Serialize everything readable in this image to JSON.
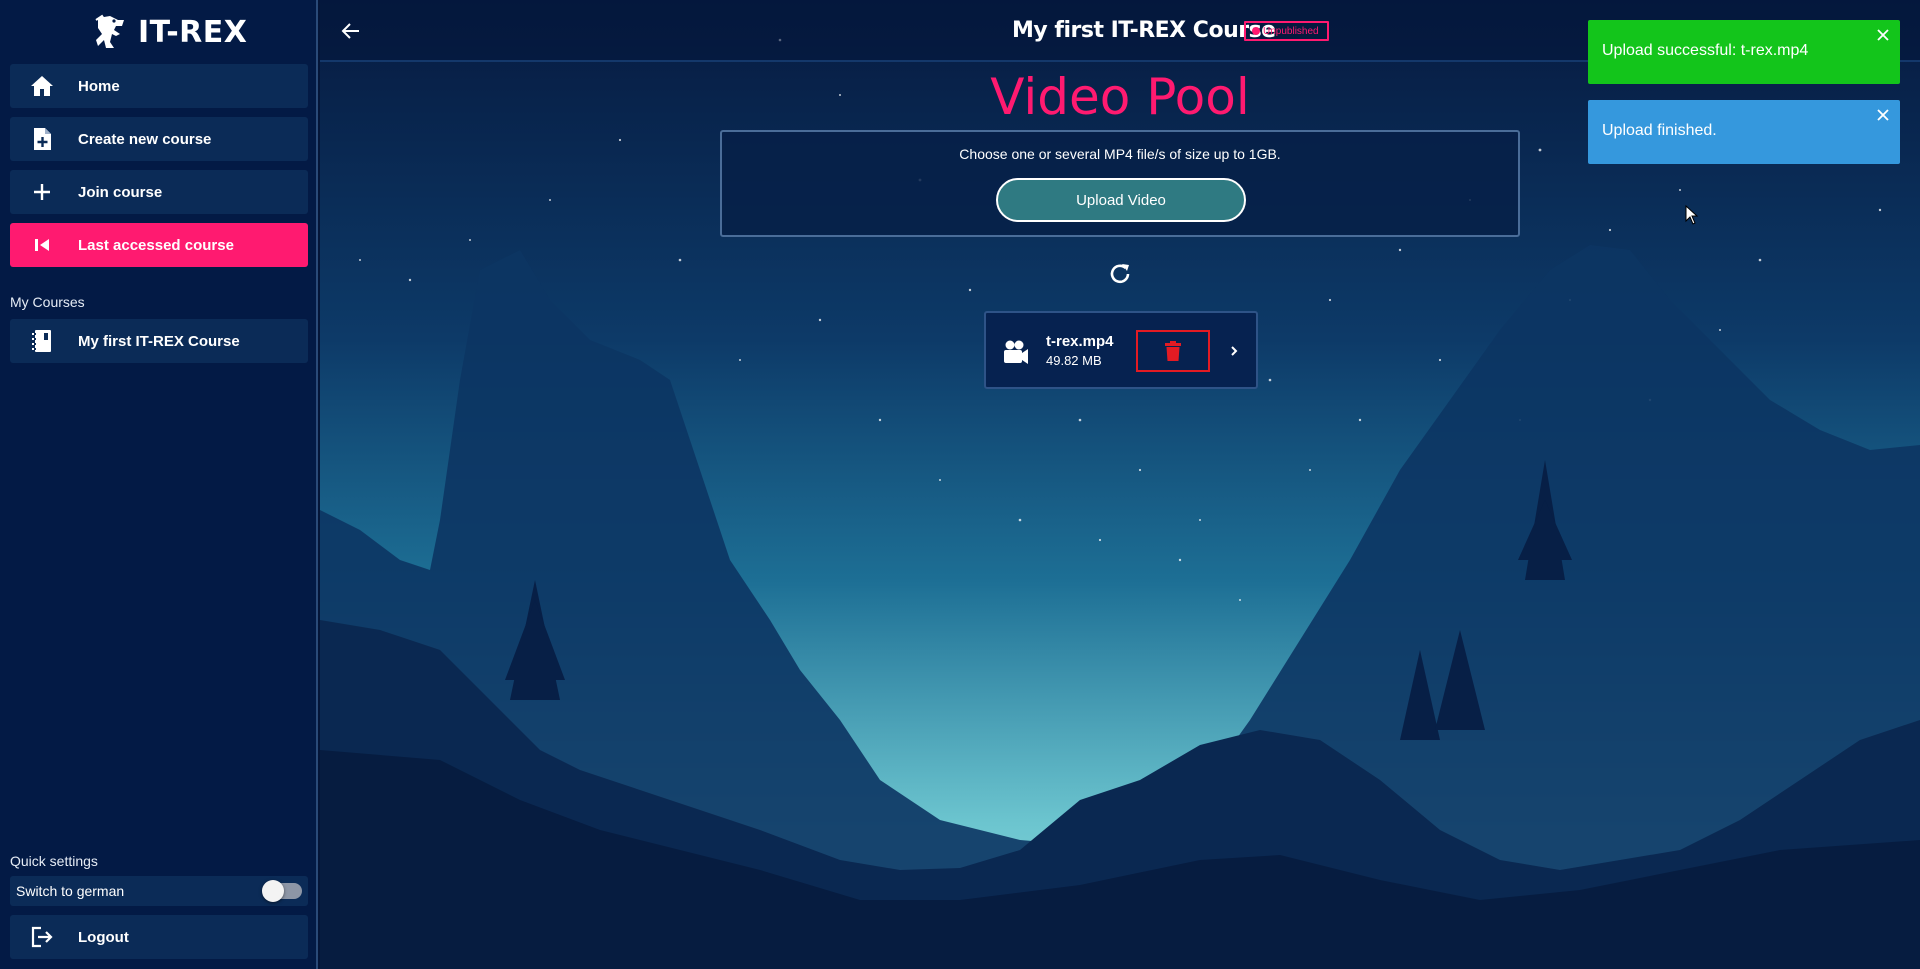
{
  "app": {
    "brand": "IT-REX"
  },
  "sidebar": {
    "items": [
      {
        "label": "Home",
        "icon": "home-icon"
      },
      {
        "label": "Create new course",
        "icon": "file-plus-icon"
      },
      {
        "label": "Join course",
        "icon": "plus-icon"
      },
      {
        "label": "Last accessed course",
        "icon": "skip-back-icon",
        "active": true
      }
    ],
    "my_courses_label": "My Courses",
    "courses": [
      {
        "label": "My first IT-REX Course",
        "icon": "notebook-icon"
      }
    ],
    "quick_settings_label": "Quick settings",
    "toggle_label": "Switch to german",
    "toggle_on": false,
    "logout_label": "Logout"
  },
  "header": {
    "course_title": "My first IT-REX Course",
    "status_badge": "Unpublished"
  },
  "main": {
    "page_title": "Video Pool",
    "upload_hint": "Choose one or several MP4 file/s of size up to 1GB.",
    "upload_button": "Upload Video",
    "videos": [
      {
        "name": "t-rex.mp4",
        "size": "49.82 MB"
      }
    ]
  },
  "toasts": [
    {
      "type": "success",
      "text": "Upload successful: t-rex.mp4"
    },
    {
      "type": "info",
      "text": "Upload finished."
    }
  ],
  "colors": {
    "accent": "#ff1a70",
    "sidebar_bg": "#031a45",
    "success": "#13c51b",
    "info": "#3598dd",
    "danger": "#e31b23"
  }
}
